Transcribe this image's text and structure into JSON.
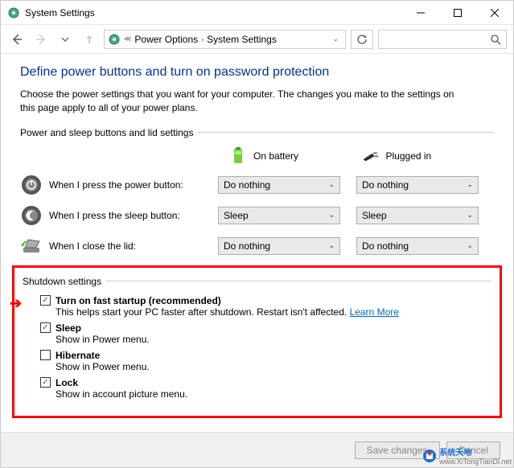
{
  "window": {
    "title": "System Settings"
  },
  "breadcrumb": {
    "items": [
      "Power Options",
      "System Settings"
    ]
  },
  "main": {
    "heading": "Define power buttons and turn on password protection",
    "desc": "Choose the power settings that you want for your computer. The changes you make to the settings on this page apply to all of your power plans."
  },
  "section_power": {
    "legend": "Power and sleep buttons and lid settings",
    "col_battery": "On battery",
    "col_plugged": "Plugged in",
    "rows": [
      {
        "label": "When I press the power button:",
        "battery": "Do nothing",
        "plugged": "Do nothing"
      },
      {
        "label": "When I press the sleep button:",
        "battery": "Sleep",
        "plugged": "Sleep"
      },
      {
        "label": "When I close the lid:",
        "battery": "Do nothing",
        "plugged": "Do nothing"
      }
    ]
  },
  "section_shutdown": {
    "legend": "Shutdown settings",
    "items": [
      {
        "checked": true,
        "label": "Turn on fast startup (recommended)",
        "sub_pre": "This helps start your PC faster after shutdown. Restart isn't affected. ",
        "link": "Learn More"
      },
      {
        "checked": true,
        "label": "Sleep",
        "sub": "Show in Power menu."
      },
      {
        "checked": false,
        "label": "Hibernate",
        "sub": "Show in Power menu."
      },
      {
        "checked": true,
        "label": "Lock",
        "sub": "Show in account picture menu."
      }
    ]
  },
  "footer": {
    "save": "Save changes",
    "cancel": "Cancel"
  },
  "watermark": {
    "main": "系统天地",
    "sub": "www.XiTongTianDi.net"
  }
}
